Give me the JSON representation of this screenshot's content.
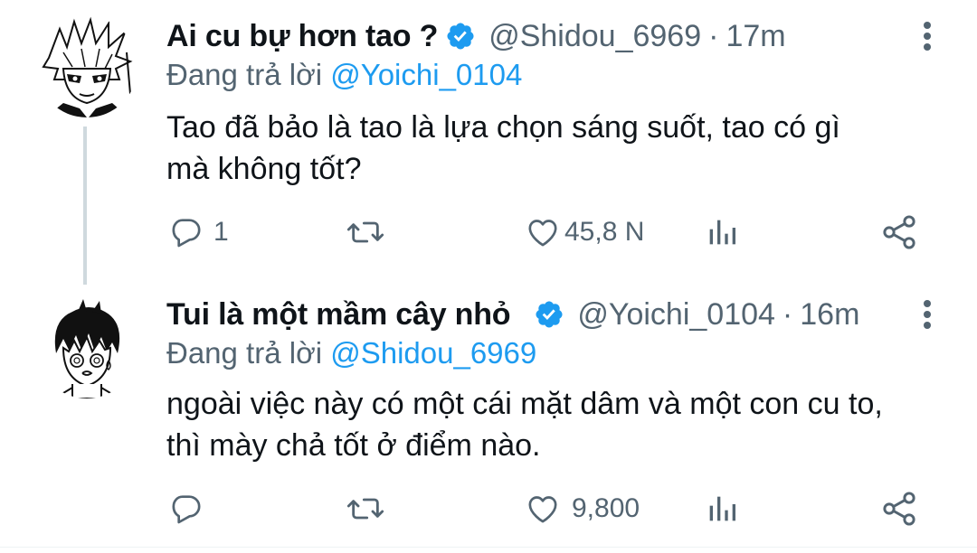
{
  "tweets": [
    {
      "display_name": "Ai cu bự hơn tao ?",
      "handle": "@Shidou_6969",
      "separator": "·",
      "time": "17m",
      "reply_prefix": "Đang trả lời",
      "reply_to": "@Yoichi_0104",
      "text_line1": "Tao đã bảo là tao là lựa chọn sáng suốt, tao có gì",
      "text_line2": "mà không tốt?",
      "reply_count": "1",
      "retweet_count": "",
      "like_count": "45,8 N",
      "verified": true,
      "avatar_icon": "manga-character-white-hair-avatar"
    },
    {
      "display_name": "Tui là một mầm cây nhỏ",
      "handle": "@Yoichi_0104",
      "separator": "·",
      "time": "16m",
      "reply_prefix": "Đang trả lời",
      "reply_to": "@Shidou_6969",
      "text_line1": "ngoài việc này có một cái mặt dâm và một con cu to,",
      "text_line2": "thì mày chả tốt ở điểm nào.",
      "reply_count": "",
      "retweet_count": "",
      "like_count": "9,800",
      "verified": true,
      "avatar_icon": "manga-character-black-hair-avatar"
    }
  ],
  "icons": {
    "reply": "reply-bubble-icon",
    "retweet": "retweet-icon",
    "like": "heart-icon",
    "views": "views-chart-icon",
    "share": "share-icon",
    "more": "more-vertical-icon",
    "verified": "verified-badge-icon"
  },
  "colors": {
    "accent": "#1d9bf0",
    "text_primary": "#0f1419",
    "text_secondary": "#536471",
    "thread_line": "#cfd9de"
  }
}
